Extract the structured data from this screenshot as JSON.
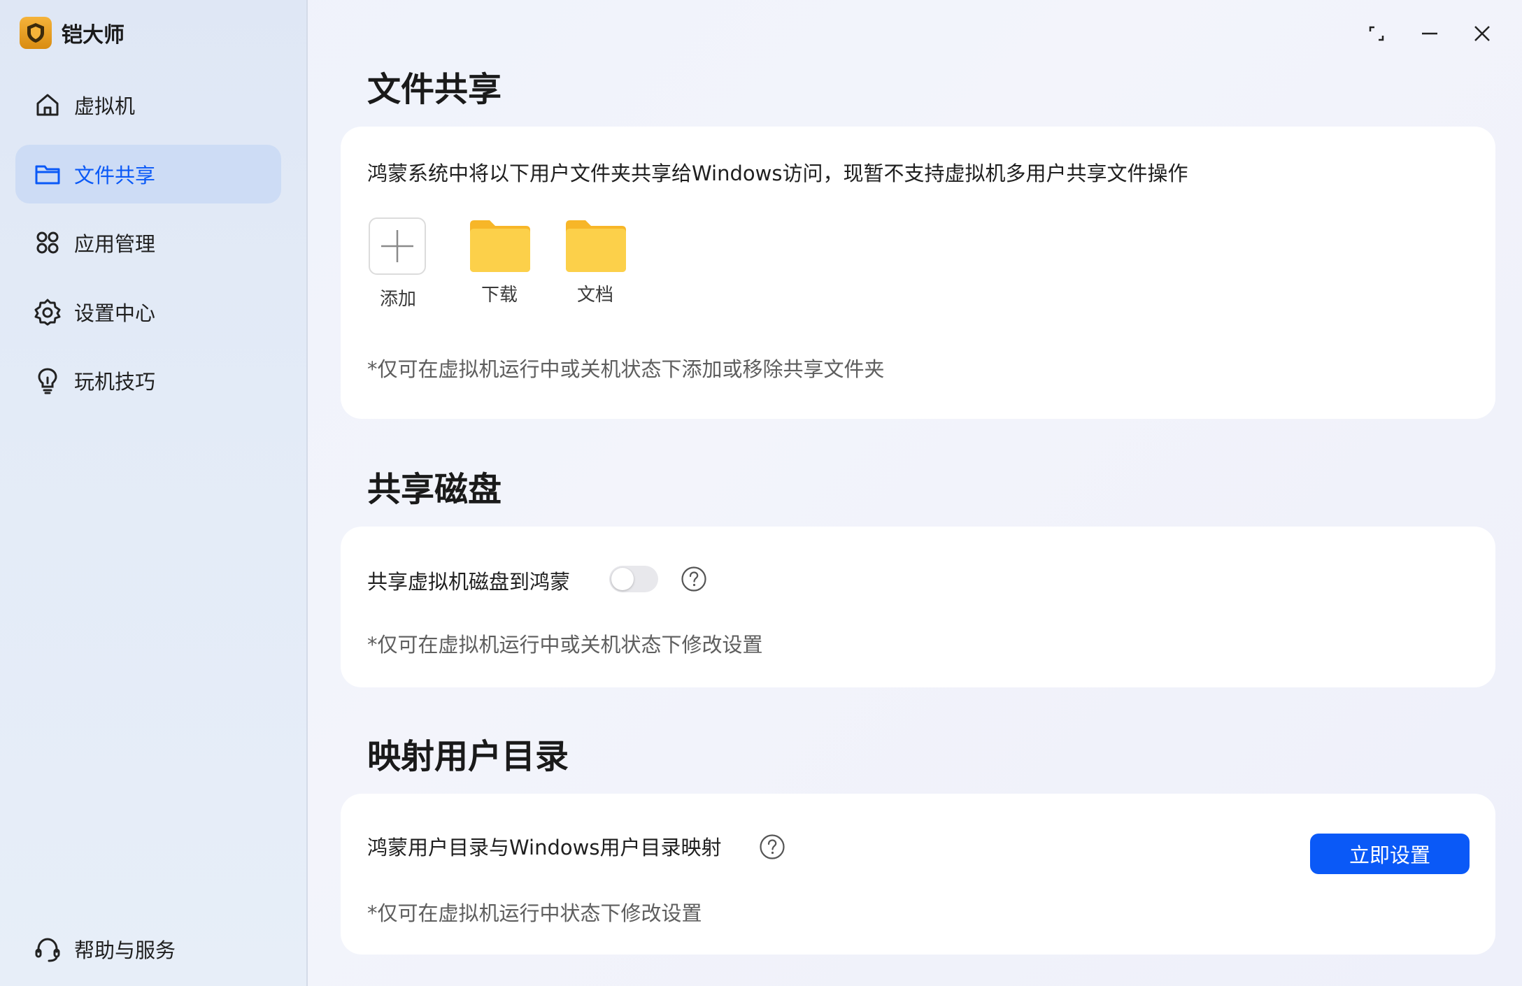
{
  "app": {
    "name": "铠大师"
  },
  "sidebar": {
    "items": [
      {
        "label": "虚拟机",
        "icon": "home-icon",
        "active": false
      },
      {
        "label": "文件共享",
        "icon": "folder-icon",
        "active": true
      },
      {
        "label": "应用管理",
        "icon": "apps-grid-icon",
        "active": false
      },
      {
        "label": "设置中心",
        "icon": "gear-icon",
        "active": false
      },
      {
        "label": "玩机技巧",
        "icon": "lightbulb-icon",
        "active": false
      }
    ],
    "help": {
      "label": "帮助与服务",
      "icon": "headset-icon"
    }
  },
  "window_controls": [
    "restore-icon",
    "minimize-icon",
    "close-icon"
  ],
  "file_share": {
    "title": "文件共享",
    "description": "鸿蒙系统中将以下用户文件夹共享给Windows访问，现暂不支持虚拟机多用户共享文件操作",
    "tiles": [
      {
        "label": "添加",
        "type": "add"
      },
      {
        "label": "下载",
        "type": "folder"
      },
      {
        "label": "文档",
        "type": "folder"
      }
    ],
    "note": "*仅可在虚拟机运行中或关机状态下添加或移除共享文件夹"
  },
  "shared_disk": {
    "title": "共享磁盘",
    "toggle_label": "共享虚拟机磁盘到鸿蒙",
    "toggle_on": false,
    "note": "*仅可在虚拟机运行中或关机状态下修改设置"
  },
  "user_dir": {
    "title": "映射用户目录",
    "label": "鸿蒙用户目录与Windows用户目录映射",
    "button": "立即设置",
    "note": "*仅可在虚拟机运行中状态下修改设置"
  },
  "colors": {
    "accent": "#0a59f7",
    "folder": "#f9c232",
    "active_bg": "#cddcf5"
  }
}
